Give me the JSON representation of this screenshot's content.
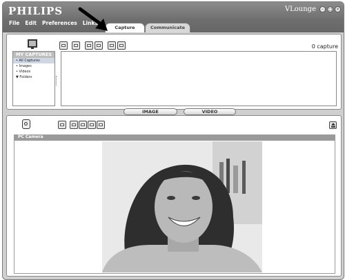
{
  "brand": "PHILIPS",
  "app_name": "VLounge",
  "window_controls": [
    "minimize-icon",
    "maximize-icon",
    "close-icon"
  ],
  "menu": [
    "File",
    "Edit",
    "Preferences",
    "Links"
  ],
  "tabs": {
    "active": "Capture",
    "inactive": "Communicate"
  },
  "library": {
    "count_text": "0 capture",
    "sidebar_title": "MY CAPTURES",
    "items": [
      {
        "label": "• All Captures",
        "selected": true
      },
      {
        "label": "• Images",
        "selected": false
      },
      {
        "label": "• Videos",
        "selected": false
      },
      {
        "label": "▼ Folders",
        "selected": false
      }
    ]
  },
  "splitter": {
    "image": "IMAGE",
    "video": "VIDEO"
  },
  "camera": {
    "header": "PC Camera"
  },
  "colors": {
    "titlebar": "#777777",
    "panel_bg": "#cfcfcf",
    "header_gray": "#9a9a9a"
  }
}
